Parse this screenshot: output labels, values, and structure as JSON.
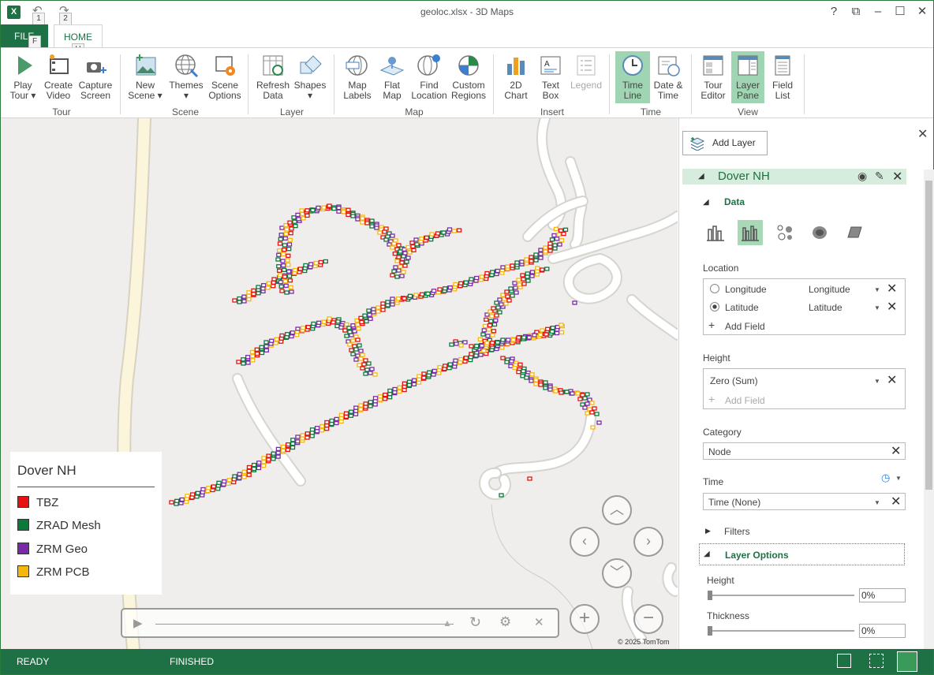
{
  "window": {
    "title": "geoloc.xlsx - 3D Maps",
    "app_icon": "excel-icon"
  },
  "quick_access": {
    "keytip_1": "1",
    "keytip_2": "2"
  },
  "tabs": {
    "file": "FILE",
    "file_keytip": "F",
    "home": "HOME",
    "home_keytip": "H"
  },
  "ribbon": {
    "groups": {
      "tour": "Tour",
      "scene": "Scene",
      "layer": "Layer",
      "map": "Map",
      "insert": "Insert",
      "time": "Time",
      "view": "View"
    },
    "buttons": {
      "play_tour": "Play\nTour ▾",
      "create_video": "Create\nVideo",
      "capture_screen": "Capture\nScreen",
      "new_scene": "New\nScene ▾",
      "themes": "Themes\n▾",
      "scene_options": "Scene\nOptions",
      "refresh_data": "Refresh\nData",
      "shapes": "Shapes\n▾",
      "map_labels": "Map\nLabels",
      "flat_map": "Flat\nMap",
      "find_location": "Find\nLocation",
      "custom_regions": "Custom\nRegions",
      "chart_2d": "2D\nChart",
      "text_box": "Text\nBox",
      "legend": "Legend",
      "time_line": "Time\nLine",
      "date_time": "Date &\nTime",
      "tour_editor": "Tour\nEditor",
      "layer_pane": "Layer\nPane",
      "field_list": "Field\nList"
    }
  },
  "legend": {
    "title": "Dover NH",
    "items": [
      {
        "label": "TBZ",
        "color": "#e81010"
      },
      {
        "label": "ZRAD Mesh",
        "color": "#0a7a3a"
      },
      {
        "label": "ZRM Geo",
        "color": "#7a2aa8"
      },
      {
        "label": "ZRM PCB",
        "color": "#f5b80a"
      }
    ]
  },
  "map": {
    "copyright": "© 2025 TomTom"
  },
  "pane": {
    "add_layer": "Add Layer",
    "layer_name": "Dover NH",
    "data_section": "Data",
    "location_label": "Location",
    "longitude": {
      "name": "Longitude",
      "value": "Longitude"
    },
    "latitude": {
      "name": "Latitude",
      "value": "Latitude"
    },
    "add_field": "Add Field",
    "height_label": "Height",
    "height_value": "Zero (Sum)",
    "height_add_field": "Add Field",
    "category_label": "Category",
    "category_value": "Node",
    "time_label": "Time",
    "time_value": "Time (None)",
    "filters": "Filters",
    "layer_options": "Layer Options",
    "opt_height": "Height",
    "opt_height_value": "0%",
    "opt_thickness": "Thickness",
    "opt_thickness_value": "0%"
  },
  "status": {
    "ready": "READY",
    "finished": "FINISHED"
  }
}
